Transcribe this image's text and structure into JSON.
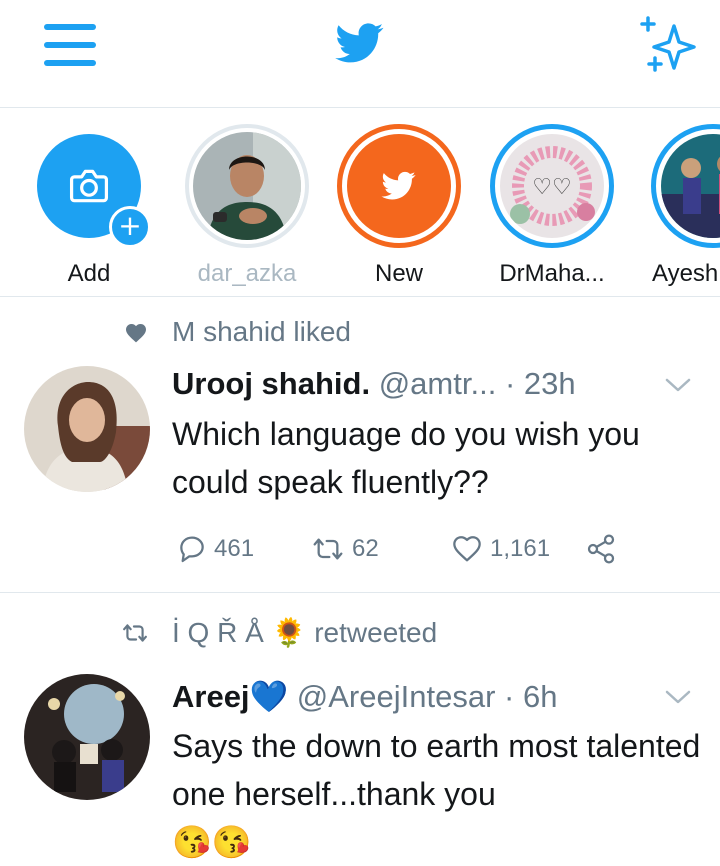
{
  "colors": {
    "accent": "#1da1f2",
    "muted": "#657786",
    "text": "#14171a",
    "orange": "#f4671d"
  },
  "header": {
    "menu_icon": "hamburger-menu-icon",
    "logo": "twitter-bird-logo",
    "sparkle_icon": "sparkle-icon"
  },
  "stories": [
    {
      "label": "Add"
    },
    {
      "label": "dar_azka"
    },
    {
      "label": "New"
    },
    {
      "label": "DrMaha..."
    },
    {
      "label": "Ayesh"
    }
  ],
  "tweets": [
    {
      "context": "M shahid liked",
      "name": "Urooj shahid.",
      "handle": "@amtr...",
      "time": "· 23h",
      "text": "Which language do you wish you could speak fluently??",
      "replies": "461",
      "retweets": "62",
      "likes": "1,161"
    },
    {
      "context_name": "İ Q Ř Å",
      "context_emoji": "🌻",
      "context_suffix": "retweeted",
      "name": "Areej",
      "name_emoji": "💙",
      "handle": "@AreejIntesar",
      "time": "· 6h",
      "text": "Says the down to earth most talented one herself...thank you",
      "text_emoji": "😘😘"
    }
  ]
}
